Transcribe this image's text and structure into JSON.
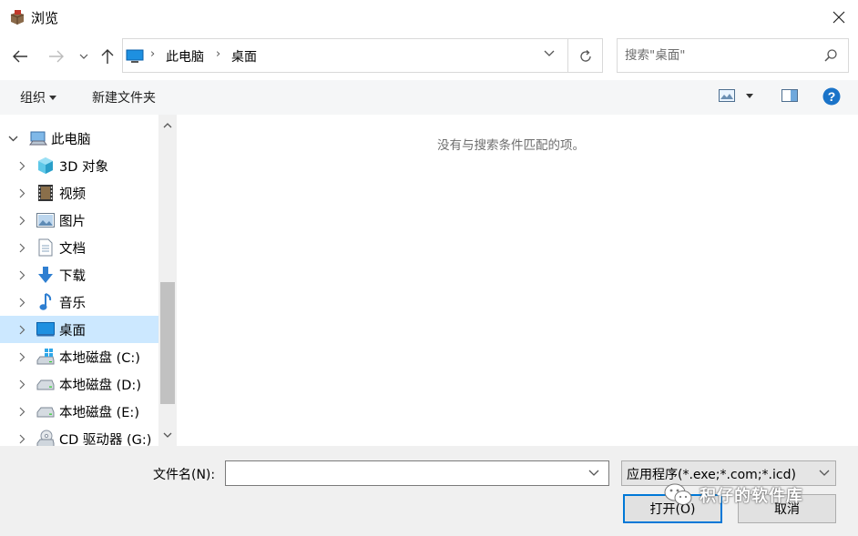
{
  "window": {
    "title": "浏览",
    "close_symbol": "✕"
  },
  "nav": {
    "back": "back-arrow",
    "forward": "forward-arrow",
    "recent": "chevron-down",
    "up": "up-arrow"
  },
  "address": {
    "crumbs": [
      "此电脑",
      "桌面"
    ],
    "separator": "›"
  },
  "search": {
    "placeholder": "搜索\"桌面\""
  },
  "toolbar": {
    "organize": "组织",
    "new_folder": "新建文件夹",
    "help_symbol": "?"
  },
  "tree": {
    "items": [
      {
        "label": "此电脑",
        "icon": "computer-icon",
        "expanded": true,
        "selected": false
      },
      {
        "label": "3D 对象",
        "icon": "3d-objects-icon",
        "selected": false
      },
      {
        "label": "视频",
        "icon": "video-icon",
        "selected": false
      },
      {
        "label": "图片",
        "icon": "pictures-icon",
        "selected": false
      },
      {
        "label": "文档",
        "icon": "documents-icon",
        "selected": false
      },
      {
        "label": "下载",
        "icon": "download-icon",
        "selected": false
      },
      {
        "label": "音乐",
        "icon": "music-icon",
        "selected": false
      },
      {
        "label": "桌面",
        "icon": "desktop-icon",
        "selected": true
      },
      {
        "label": "本地磁盘 (C:)",
        "icon": "windows-drive-icon",
        "selected": false
      },
      {
        "label": "本地磁盘 (D:)",
        "icon": "drive-icon",
        "selected": false
      },
      {
        "label": "本地磁盘 (E:)",
        "icon": "drive-icon",
        "selected": false
      },
      {
        "label": "CD 驱动器 (G:)",
        "icon": "cd-drive-icon",
        "selected": false
      }
    ]
  },
  "content": {
    "empty_message": "没有与搜索条件匹配的项。"
  },
  "bottom": {
    "filename_label": "文件名(N):",
    "filename_value": "",
    "filetype": "应用程序(*.exe;*.com;*.icd)",
    "open": "打开(O)",
    "cancel": "取消"
  },
  "watermark": {
    "text": "积仔的软件库",
    "icon": "wechat-icon"
  },
  "colors": {
    "selection": "#cce8ff",
    "accent": "#0078d7",
    "toolbar_bg": "#f5f6f7",
    "bottom_bg": "#f0f0f0"
  }
}
